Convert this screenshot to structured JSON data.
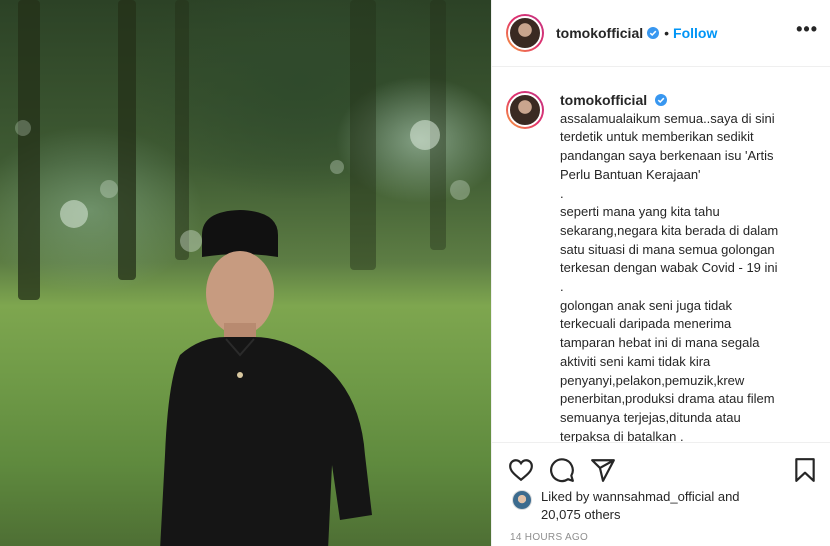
{
  "post": {
    "username": "tomokofficial",
    "follow_label": "Follow",
    "separator": "•",
    "more_label": "•••"
  },
  "caption": {
    "username": "tomokofficial",
    "lines": [
      "assalamualaikum semua..saya di sini",
      "terdetik untuk memberikan sedikit",
      "pandangan saya berkenaan isu 'Artis",
      "Perlu Bantuan Kerajaan'",
      ".",
      "seperti mana yang kita tahu",
      "sekarang,negara kita berada di dalam",
      "satu situasi di mana semua golongan",
      "terkesan dengan wabak Covid - 19 ini",
      ".",
      "golongan anak seni juga tidak",
      "terkecuali daripada menerima",
      "tamparan hebat ini di mana segala",
      "aktiviti seni kami tidak kira",
      "penyanyi,pelakon,pemuzik,krew",
      "penerbitan,produksi drama atau filem",
      "semuanya terjejas,ditunda atau",
      "terpaksa di batalkan ."
    ]
  },
  "likes": {
    "prefix": "Liked by",
    "user": "wannsahmad_official",
    "middle": "and",
    "count": "20,075 others"
  },
  "timestamp": "14 HOURS AGO",
  "icons": [
    "heart-icon",
    "comment-icon",
    "share-icon",
    "bookmark-icon",
    "verified-icon",
    "more-options-icon"
  ],
  "colors": {
    "follow": "#0095f6",
    "verified": "#3897f0",
    "muted": "#8e8e8e"
  }
}
